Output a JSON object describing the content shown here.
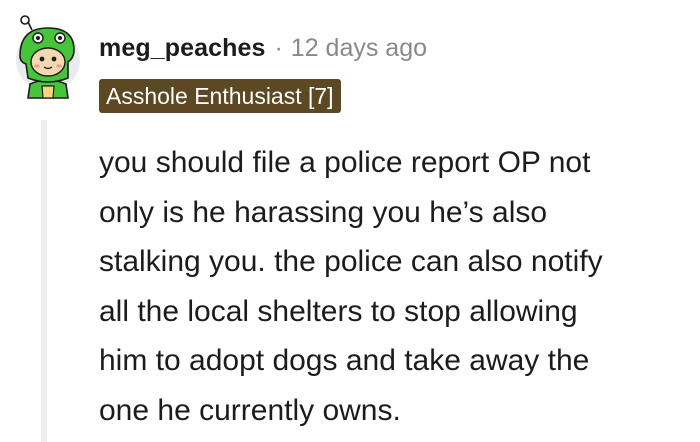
{
  "comment": {
    "username": "meg_peaches",
    "separator": "·",
    "timestamp": "12 days ago",
    "flair": "Asshole Enthusiast [7]",
    "body_lines": [
      "you should file a police report OP not",
      "only is he harassing you he’s also",
      "stalking you. the police can also notify",
      "all the local shelters to stop allowing",
      "him to adopt dogs and take away the",
      "one he currently owns."
    ]
  },
  "colors": {
    "flair_background": "#5c4823",
    "flair_text": "#ffffff",
    "meta_text": "#878a8c",
    "body_text": "#1c1c1c",
    "thread_line": "#edeff1"
  },
  "icons": {
    "avatar": "snoo-avatar-icon"
  }
}
